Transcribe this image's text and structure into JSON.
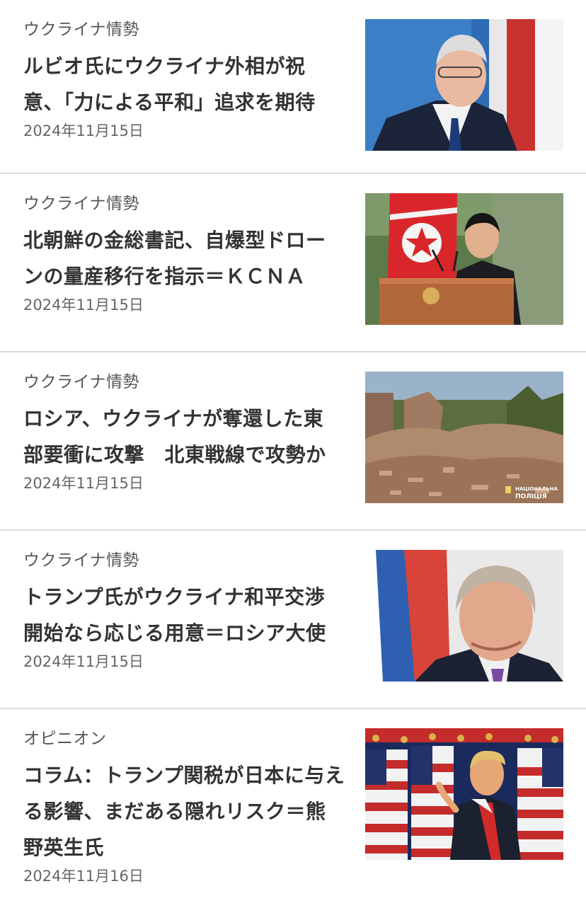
{
  "articles": [
    {
      "category": "ウクライナ情勢",
      "headline_lines": [
        "ルビオ氏にウクライナ外相が祝",
        "意、「力による平和」追求を期待"
      ],
      "date": "2024年11月15日",
      "image_icon": "photo-ukrainian-foreign-minister"
    },
    {
      "category": "ウクライナ情勢",
      "headline_lines": [
        "北朝鮮の金総書記、自爆型ドロー",
        "ンの量産移行を指示＝ＫＣＮＡ"
      ],
      "date": "2024年11月15日",
      "image_icon": "photo-north-korea-leader-podium"
    },
    {
      "category": "ウクライナ情勢",
      "headline_lines": [
        "ロシア、ウクライナが奪還した東",
        "部要衝に攻撃　北東戦線で攻勢か"
      ],
      "date": "2024年11月15日",
      "image_icon": "photo-destroyed-buildings-rubble",
      "image_watermark": [
        "НАЦІОНАЛЬНА",
        "ПОЛІЦІЯ"
      ]
    },
    {
      "category": "ウクライナ情勢",
      "headline_lines": [
        "トランプ氏がウクライナ和平交渉",
        "開始なら応じる用意＝ロシア大使"
      ],
      "date": "2024年11月15日",
      "image_icon": "photo-russian-ambassador"
    },
    {
      "category": "オピニオン",
      "headline_lines": [
        "コラム：トランプ関税が日本に与え",
        "る影響、まだある隠れリスク＝熊",
        "野英生氏"
      ],
      "date": "2024年11月16日",
      "image_icon": "photo-trump-with-flags"
    }
  ]
}
